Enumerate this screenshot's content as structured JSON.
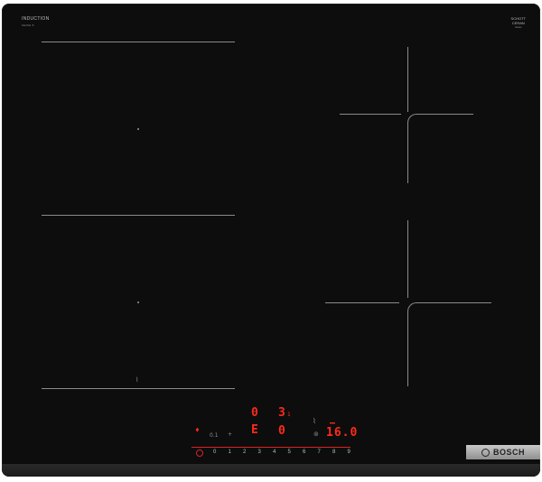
{
  "brand": {
    "top_left_title": "INDUCTION",
    "top_left_sub": "SERIE 8",
    "top_right_title": "SCHOTT",
    "top_right_mid": "CERAN",
    "top_right_sub": "Glass",
    "logo_text": "BOSCH"
  },
  "display": {
    "zone_a_value": "0",
    "zone_b_value": "3",
    "zone_b_suffix": "1",
    "zone_c_value": "E",
    "zone_d_value": "0",
    "timer_value": "16.0",
    "small_left": "0.1",
    "small_mid": "+"
  },
  "scale": {
    "labels": [
      "0",
      "1",
      "2",
      "3",
      "4",
      "5",
      "6",
      "7",
      "8",
      "9"
    ]
  },
  "colors": {
    "glass": "#0d0d0d",
    "display_red": "#ff2a1a",
    "line": "#8a8a8a"
  }
}
